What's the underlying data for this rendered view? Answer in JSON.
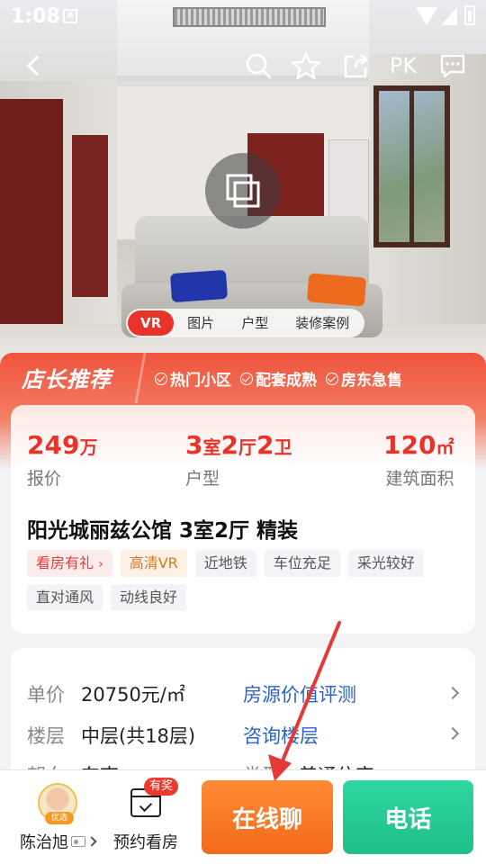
{
  "status_bar": {
    "time": "1:08",
    "notification_icon": "A"
  },
  "nav": {
    "pk_label": "PK"
  },
  "media_tabs": [
    "VR",
    "图片",
    "户型",
    "装修案例"
  ],
  "banner": {
    "title": "店长推荐",
    "tags": [
      "热门小区",
      "配套成熟",
      "房东急售"
    ]
  },
  "stats": {
    "price": {
      "value": "249",
      "unit": "万",
      "label": "报价"
    },
    "layout": {
      "n1": "3",
      "u1": "室",
      "n2": "2",
      "u2": "厅",
      "n3": "2",
      "u3": "卫",
      "label": "户型"
    },
    "area": {
      "value": "120",
      "unit": "㎡",
      "label": "建筑面积"
    }
  },
  "listing": {
    "title": "阳光城丽兹公馆 3室2厅 精装",
    "tags": [
      {
        "text": "看房有礼",
        "style": "red"
      },
      {
        "text": "高清VR",
        "style": "orange"
      },
      {
        "text": "近地铁",
        "style": "gray"
      },
      {
        "text": "车位充足",
        "style": "gray"
      },
      {
        "text": "采光较好",
        "style": "gray"
      },
      {
        "text": "直对通风",
        "style": "gray"
      },
      {
        "text": "动线良好",
        "style": "gray"
      }
    ]
  },
  "details": {
    "unit_price": {
      "key": "单价",
      "value": "20750元/㎡",
      "link": "房源价值评测"
    },
    "floor": {
      "key": "楼层",
      "value": "中层(共18层)",
      "link": "咨询楼层"
    },
    "orientation_partial": {
      "key": "朝向",
      "value": "东南",
      "link_key": "类型",
      "link_value": "普通住宅"
    }
  },
  "bottom_bar": {
    "agent_name": "陈治旭",
    "agent_badge": "优选",
    "appointment_label": "预约看房",
    "appointment_badge": "有奖",
    "chat_label": "在线聊",
    "phone_label": "电话"
  },
  "colors": {
    "accent_red": "#e8332a",
    "chat_orange": "#f26a1b",
    "phone_green": "#1fbf8a",
    "link_blue": "#2b63c6"
  }
}
